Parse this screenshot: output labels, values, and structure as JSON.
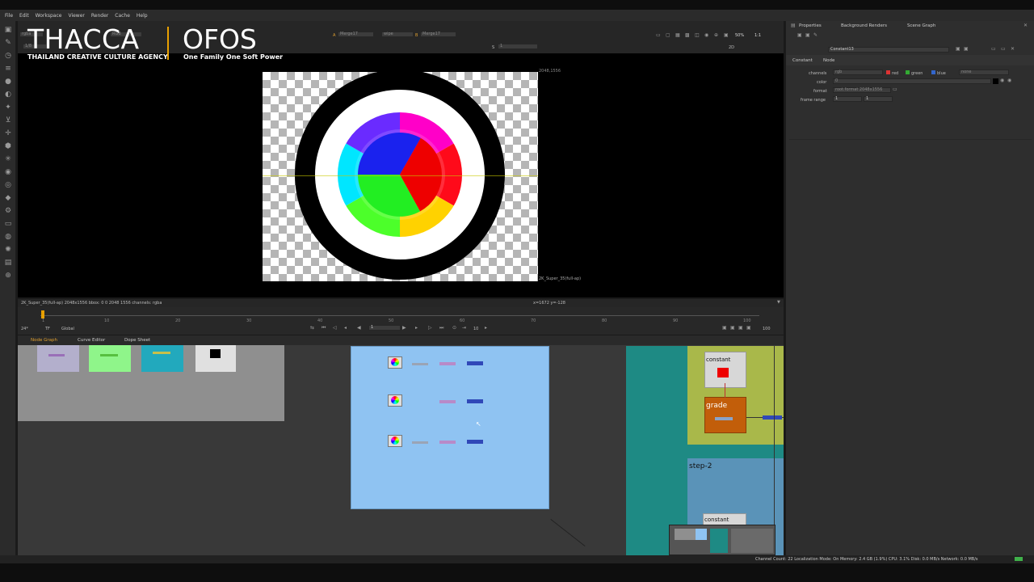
{
  "menu": [
    "File",
    "Edit",
    "Workspace",
    "Viewer",
    "Render",
    "Cache",
    "Help"
  ],
  "logo": {
    "left_title": "THACCA",
    "left_subtitle": "THAILAND CREATIVE CULTURE AGENCY",
    "right_title": "OFOS",
    "right_subtitle": "One Family One Soft Power"
  },
  "viewer": {
    "channel_select": "rgba",
    "channel_rgb": "RGB",
    "input_a_label": "A",
    "input_a_value": "Merge17",
    "wipe_value": "wipe",
    "input_b_label": "B",
    "input_b_value": "Merge17",
    "zoom": "50%",
    "ratio": "1:1",
    "frame_field": "S",
    "frame_value": "1",
    "view_mode": "2D",
    "gain_value": "1/8",
    "format_top_right": "2048,1556",
    "format_bottom_right": "2K_Super_35(full-ap)",
    "info_left": "2K_Super_35(full-ap) 2048x1556 bbox: 0 0 2048 1556 channels: rgba",
    "info_coords": "x=1672 y=-128"
  },
  "timeline": {
    "ticks": [
      "1",
      "10",
      "20",
      "30",
      "40",
      "50",
      "60",
      "70",
      "80",
      "90",
      "100"
    ],
    "fps": "24*",
    "tf": "TF",
    "global": "Global",
    "current_frame": "1",
    "step": "10",
    "end_frame": "100"
  },
  "node_tabs": [
    "Node Graph",
    "Curve Editor",
    "Dope Sheet"
  ],
  "properties": {
    "tabs": [
      "Properties",
      "Background Renders",
      "Scene Graph"
    ],
    "node_name": "Constant13",
    "subtabs": [
      "Constant",
      "Node"
    ],
    "channels_label": "channels",
    "channels_value": "rgb",
    "red": "red",
    "green": "green",
    "blue": "blue",
    "extra_channel": "none",
    "color_label": "color",
    "color_value": "0",
    "format_label": "format",
    "format_value": "root.format 2048x1556",
    "frame_range_label": "frame range",
    "frame_range_start": "1",
    "frame_range_end": "1"
  },
  "nodes": {
    "constant_label_1": "constant",
    "grade_label": "grade",
    "step_label": "step-2",
    "constant_label_2": "constant"
  },
  "status_bar": "Channel Count: 22  Localization Mode: On  Memory: 2.4 GB (1.9%)  CPU: 3.1%  Disk: 0.0 MB/s  Network: 0.0 MB/s",
  "colors": {
    "accent_orange": "#e8a000",
    "backdrop_blue": "#8fc3f2",
    "backdrop_teal": "#1e8a84",
    "backdrop_green": "#a9b84a",
    "grade_node": "#c25e0a",
    "constant_red": "#ee0000"
  }
}
